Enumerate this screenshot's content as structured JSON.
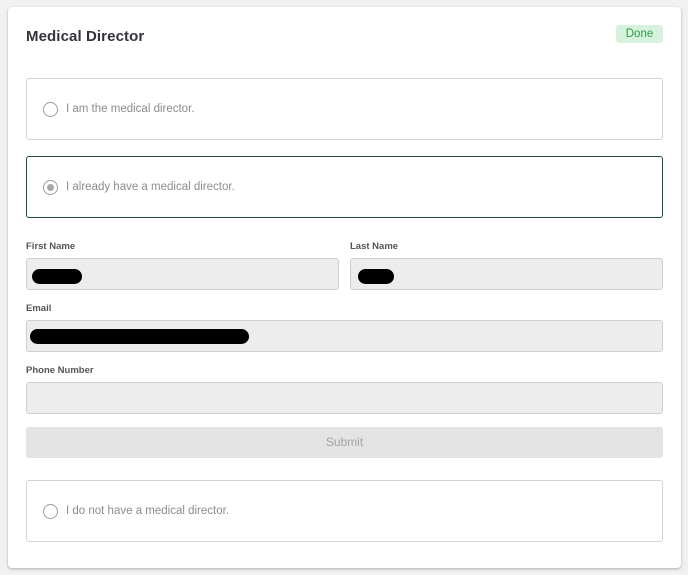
{
  "card": {
    "title": "Medical Director",
    "status_badge": "Done"
  },
  "options": [
    {
      "label": "I am the medical director.",
      "selected": false
    },
    {
      "label": "I already have a medical director.",
      "selected": true
    },
    {
      "label": "I do not have a medical director.",
      "selected": false
    }
  ],
  "form": {
    "first_name_label": "First Name",
    "last_name_label": "Last Name",
    "email_label": "Email",
    "phone_label": "Phone Number",
    "first_name_value": "",
    "last_name_value": "",
    "email_value": "",
    "phone_value": "",
    "submit_label": "Submit"
  },
  "colors": {
    "badge_bg": "#d6f2dc",
    "badge_text": "#2b9a48",
    "selected_border": "#1f4d36"
  }
}
